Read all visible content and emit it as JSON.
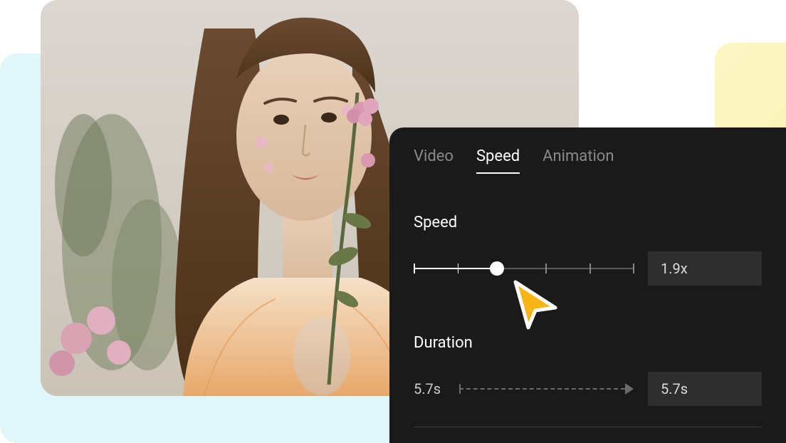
{
  "tabs": {
    "video": "Video",
    "speed": "Speed",
    "animation": "Animation"
  },
  "speed": {
    "label": "Speed",
    "value": "1.9x",
    "percent": 38
  },
  "duration": {
    "label": "Duration",
    "start": "5.7s",
    "value": "5.7s"
  },
  "preview": {
    "alt": "woman-with-flowers-portrait"
  }
}
